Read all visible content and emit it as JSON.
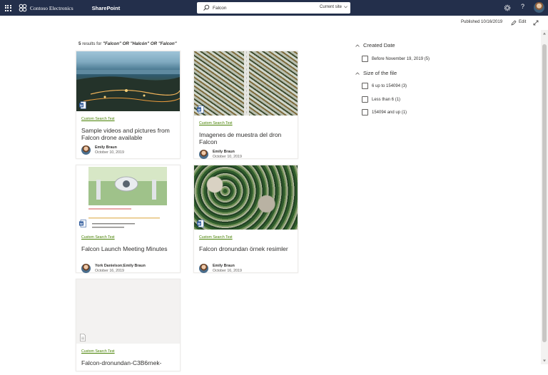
{
  "suite_bar": {
    "brand": "Contoso Electronics",
    "app": "SharePoint",
    "search": {
      "value": "Falcon",
      "scope": "Current site"
    }
  },
  "command_bar": {
    "published": "Published 10/16/2019",
    "edit": "Edit"
  },
  "results": {
    "count": "5",
    "label": "results for",
    "query": "\"Falcon\" OR \"Halcón\" OR \"Falcon\"",
    "cards": [
      {
        "site": "Custom Search Test",
        "title": "Sample videos and pictures from Falcon drone available",
        "author": "Emily Braun",
        "date": "October 10, 2019",
        "icon": "word-document-icon"
      },
      {
        "site": "Custom Search Test",
        "title": "Imagenes de muestra del dron Falcon",
        "author": "Emily Braun",
        "date": "October 10, 2019",
        "icon": "word-document-icon"
      },
      {
        "site": "Custom Search Test",
        "title": "Falcon Launch Meeting Minutes",
        "author": "York Danielson;Emily Braun",
        "date": "October 16, 2019",
        "icon": "word-document-icon"
      },
      {
        "site": "Custom Search Test",
        "title": "Falcon dronundan örnek resimler",
        "author": "Emily Braun",
        "date": "October 16, 2019",
        "icon": "word-document-icon"
      },
      {
        "site": "Custom Search Test",
        "title": "Falcon-dronundan-C3B6rnek-",
        "author": "",
        "date": "",
        "icon": "generic-document-icon"
      }
    ]
  },
  "filters": {
    "created_date": {
      "title": "Created Date",
      "options": [
        "Before November 19, 2019 (5)"
      ]
    },
    "file_size": {
      "title": "Size of the file",
      "options": [
        "6 up to 154094 (3)",
        "Less than 6 (1)",
        "154094 and up (1)"
      ]
    }
  },
  "colors": {
    "suite_bar": "#232f4b",
    "site_link": "#498205",
    "word_blue": "#2b579a"
  }
}
